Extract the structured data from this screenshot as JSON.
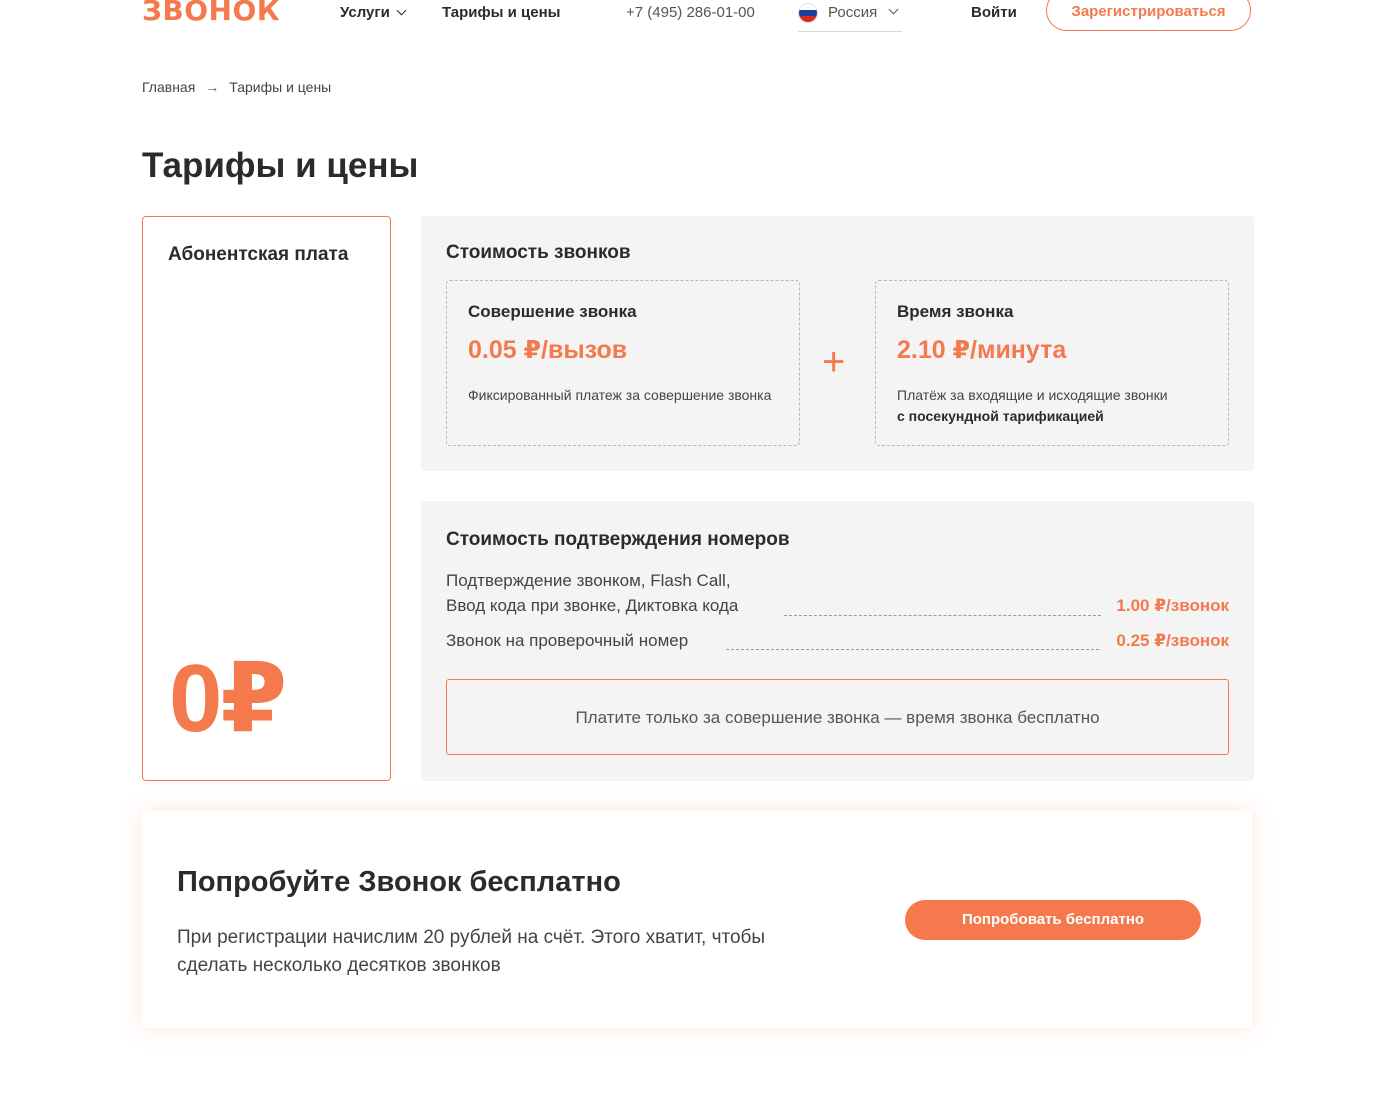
{
  "header": {
    "logo": "ЗВОНОК",
    "nav": {
      "services": "Услуги",
      "tariffs": "Тарифы и цены"
    },
    "phone": "+7 (495) 286-01-00",
    "region": "Россия",
    "login": "Войти",
    "register": "Зарегистрироваться"
  },
  "breadcrumb": {
    "home": "Главная",
    "separator": "→",
    "current": "Тарифы и цены"
  },
  "page_title": "Тарифы и цены",
  "subscription": {
    "title": "Абонентская плата",
    "price": "0₽"
  },
  "calls": {
    "title": "Стоимость звонков",
    "plus": "+",
    "making": {
      "title": "Совершение звонка",
      "price": "0.05 ₽/вызов",
      "description": "Фиксированный платеж за совершение звонка"
    },
    "duration": {
      "title": "Время звонка",
      "price": "2.10 ₽/минута",
      "description": "Платёж за входящие и исходящие звонки",
      "description_bold": "с посекундной тарификацией"
    }
  },
  "verification": {
    "title": "Стоимость подтверждения номеров",
    "rows": [
      {
        "line1": "Подтверждение звонком, Flash Call,",
        "line2": "Ввод кода при звонке, Диктовка кода",
        "price": "1.00 ₽/звонок"
      },
      {
        "line1": "Звонок на проверочный номер",
        "price": "0.25 ₽/звонок"
      }
    ],
    "note": "Платите только за совершение звонка — время звонка бесплатно"
  },
  "banner": {
    "title": "Попробуйте Звонок бесплатно",
    "text_line1": "При регистрации начислим 20 рублей на счёт. Этого хватит, чтобы",
    "text_line2": "сделать несколько десятков звонков",
    "button": "Попробовать бесплатно"
  },
  "colors": {
    "accent": "#f47a4e",
    "panel": "#f4f4f4",
    "text": "#2b2b2b"
  }
}
